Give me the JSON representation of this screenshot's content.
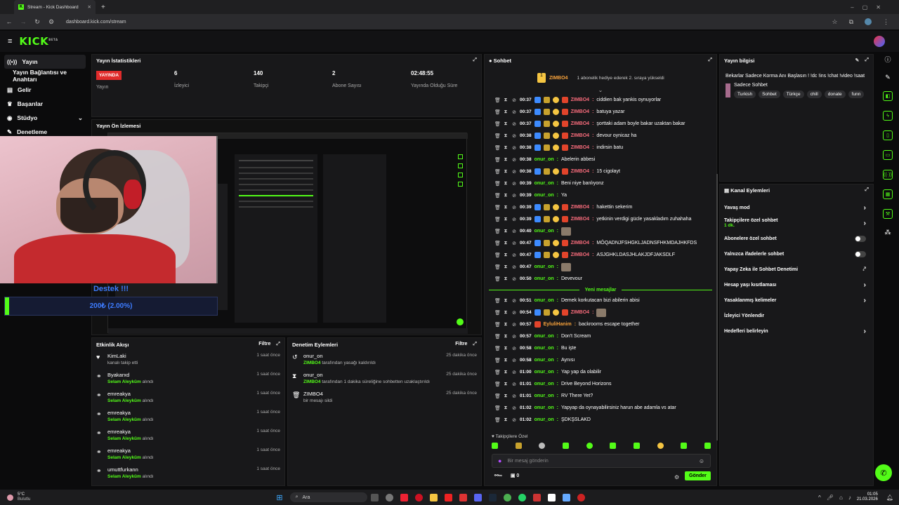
{
  "browser": {
    "tab_title": "Stream - Kick Dashboard",
    "new_tab": "+",
    "url": "dashboard.kick.com/stream"
  },
  "app": {
    "logo": "KICK",
    "logo_sup": "BETA"
  },
  "sidebar": {
    "items": [
      {
        "label": "Yayın",
        "icon": "broadcast-icon"
      },
      {
        "label": "Yayın Bağlantısı ve Anahtarı",
        "icon": ""
      },
      {
        "label": "Gelir",
        "icon": "wallet-icon"
      },
      {
        "label": "Başarılar",
        "icon": "trophy-icon"
      },
      {
        "label": "Stüdyo",
        "icon": "studio-icon"
      },
      {
        "label": "Denetleme",
        "icon": "shield-icon"
      }
    ]
  },
  "stats": {
    "title": "Yayın İstatistikleri",
    "live_badge": "YAYINDA",
    "live_label": "Yayın",
    "viewers": "6",
    "viewers_label": "İzleyici",
    "followers": "140",
    "followers_label": "Takipçi",
    "subs": "2",
    "subs_label": "Abone Sayısı",
    "uptime": "02:48:55",
    "uptime_label": "Yayında Olduğu Süre"
  },
  "preview": {
    "title": "Yayın Ön İzlemesi",
    "overlay_title": "Destek !!!",
    "overlay_amount": "200₺ (2.00%)"
  },
  "activity": {
    "title": "Etkinlik Akışı",
    "filter": "Filtre",
    "items": [
      {
        "user": "KimLaki",
        "pre": "",
        "bold": "",
        "rest": "kanalı takip etti",
        "time": "1 saat önce",
        "icon": "heart-icon"
      },
      {
        "user": "Byakarxd",
        "pre": "",
        "bold": "Selam Aleyküm",
        "rest": " alındı",
        "time": "1 saat önce",
        "icon": "reward-icon"
      },
      {
        "user": "emreakya",
        "pre": "",
        "bold": "Selam Aleyküm",
        "rest": " alındı",
        "time": "1 saat önce",
        "icon": "reward-icon"
      },
      {
        "user": "emreakya",
        "pre": "",
        "bold": "Selam Aleyküm",
        "rest": " alındı",
        "time": "1 saat önce",
        "icon": "reward-icon"
      },
      {
        "user": "emreakya",
        "pre": "",
        "bold": "Selam Aleyküm",
        "rest": " alındı",
        "time": "1 saat önce",
        "icon": "reward-icon"
      },
      {
        "user": "emreakya",
        "pre": "",
        "bold": "Selam Aleyküm",
        "rest": " alındı",
        "time": "1 saat önce",
        "icon": "reward-icon"
      },
      {
        "user": "umuttfurkann",
        "pre": "",
        "bold": "Selam Aleyküm",
        "rest": " alındı",
        "time": "1 saat önce",
        "icon": "reward-icon"
      }
    ]
  },
  "moderation": {
    "title": "Denetim Eylemleri",
    "filter": "Filtre",
    "items": [
      {
        "user": "onur_on",
        "bold": "ZIMBO4",
        "rest": " tarafından yasağı kaldırıldı",
        "time": "25 dakika önce",
        "icon": "undo-icon"
      },
      {
        "user": "onur_on",
        "bold": "ZIMBO4",
        "rest": " tarafından 1 dakika süreliğine sohbetten uzaklaştırıldı",
        "time": "25 dakika önce",
        "icon": "hourglass-icon"
      },
      {
        "user": "ZIMBO4",
        "bold": "",
        "rest": "bir mesajı sildi",
        "time": "25 dakika önce",
        "icon": "trash-icon"
      }
    ]
  },
  "chat": {
    "title": "Sohbet",
    "pinned_user": "ZIMBO4",
    "pinned_text": "1 abonelik hediye ederek 2. sıraya yükseldi",
    "messages": [
      {
        "time": "00:37",
        "user": "ZIMBO4",
        "text": "ciddien bak yankis oynuyorlar",
        "type": "z"
      },
      {
        "time": "00:37",
        "user": "ZIMBO4",
        "text": "batuya yazar",
        "type": "z"
      },
      {
        "time": "00:37",
        "user": "ZIMBO4",
        "text": "şorttaki adam boyle bakar uzaktan bakar",
        "type": "z"
      },
      {
        "time": "00:38",
        "user": "ZIMBO4",
        "text": "devour oynicaz ha",
        "type": "z"
      },
      {
        "time": "00:38",
        "user": "ZIMBO4",
        "text": "indirsin batu",
        "type": "z"
      },
      {
        "time": "00:38",
        "user": "onur_on",
        "text": "Abelerin abbesi",
        "type": "o"
      },
      {
        "time": "00:38",
        "user": "ZIMBO4",
        "text": "15 cigolayt",
        "type": "z"
      },
      {
        "time": "00:39",
        "user": "onur_on",
        "text": "Beni niye banlıyonz",
        "type": "o"
      },
      {
        "time": "00:39",
        "user": "onur_on",
        "text": "Ya",
        "type": "o"
      },
      {
        "time": "00:39",
        "user": "ZIMBO4",
        "text": "hakettin sekerim",
        "type": "z"
      },
      {
        "time": "00:39",
        "user": "ZIMBO4",
        "text": "yetkinin verdigi gücle yasakladım zuhahaha",
        "type": "z"
      },
      {
        "time": "00:40",
        "user": "onur_on",
        "text": "",
        "type": "o",
        "emote": true
      },
      {
        "time": "00:47",
        "user": "ZIMBO4",
        "text": "MÖQADNJFSHGKLJADNSFHKMDAJHKFDS",
        "type": "z"
      },
      {
        "time": "00:47",
        "user": "ZIMBO4",
        "text": "ASJGHKLDASJHLAKJDFJAKSDLF",
        "type": "z"
      },
      {
        "time": "00:47",
        "user": "onur_on",
        "text": "",
        "type": "o",
        "emote": true
      },
      {
        "time": "00:50",
        "user": "onur_on",
        "text": "Devevour",
        "type": "o"
      }
    ],
    "new_messages_label": "Yeni mesajlar",
    "messages2": [
      {
        "time": "00:51",
        "user": "onur_on",
        "text": "Demek korkutacan bizi abilerin abisi",
        "type": "o"
      },
      {
        "time": "00:54",
        "user": "ZIMBO4",
        "text": "",
        "type": "z",
        "emote": true
      },
      {
        "time": "00:57",
        "user": "EyluliHanim",
        "text": "backrooms escape together",
        "type": "e"
      },
      {
        "time": "00:57",
        "user": "onur_on",
        "text": "Don't Scream",
        "type": "o"
      },
      {
        "time": "00:58",
        "user": "onur_on",
        "text": "Bu işte",
        "type": "o"
      },
      {
        "time": "00:58",
        "user": "onur_on",
        "text": "Aynısı",
        "type": "o"
      },
      {
        "time": "01:00",
        "user": "onur_on",
        "text": "Yap yap da olabilir",
        "type": "o"
      },
      {
        "time": "01:01",
        "user": "onur_on",
        "text": "Drive Beyond Horizons",
        "type": "o"
      },
      {
        "time": "01:01",
        "user": "onur_on",
        "text": "RV There Yet?",
        "type": "o"
      },
      {
        "time": "01:02",
        "user": "onur_on",
        "text": "Yapyap da oynayabilirsiniz harun abe adamla vs atar",
        "type": "o"
      },
      {
        "time": "01:02",
        "user": "onur_on",
        "text": "ŞDKŞSLAKD",
        "type": "o"
      }
    ],
    "followers_only": "Takipçilere Özel",
    "input_placeholder": "Bir mesaj gönderin",
    "points": "0",
    "send": "Gönder"
  },
  "stream_info": {
    "title": "Yayın bilgisi",
    "stream_title": "Bekarlar Sadece Korma Anı Başlasın ! !dc !ins !chat !video !saat",
    "category": "Sadece Sohbet",
    "tags": [
      "Turkish",
      "Sohbet",
      "Türkçe",
      "chill",
      "donate",
      "funn"
    ]
  },
  "channel_actions": {
    "title": "Kanal Eylemleri",
    "items": [
      {
        "label": "Yavaş mod",
        "sub": "",
        "control": "chevron"
      },
      {
        "label": "Takipçilere özel sohbet",
        "sub": "1 dk.",
        "control": "chevron"
      },
      {
        "label": "Abonelere özel sohbet",
        "sub": "",
        "control": "toggle"
      },
      {
        "label": "Yalnızca ifadelerle sohbet",
        "sub": "",
        "control": "toggle"
      },
      {
        "label": "Yapay Zeka ile Sohbet Denetimi",
        "sub": "",
        "control": "external"
      },
      {
        "label": "Hesap yaşı kısıtlaması",
        "sub": "",
        "control": "chevron"
      },
      {
        "label": "Yasaklanmış kelimeler",
        "sub": "",
        "control": "chevron"
      },
      {
        "label": "İzleyici Yönlendir",
        "sub": "",
        "control": "none"
      },
      {
        "label": "Hedefleri belirleyin",
        "sub": "",
        "control": "chevron"
      }
    ]
  },
  "taskbar": {
    "weather_temp": "5°C",
    "weather_desc": "Bulutlu",
    "search": "Ara",
    "time": "01:05",
    "date": "21.03.2026"
  },
  "colors": {
    "accent": "#53fc18",
    "live": "#e02b2b",
    "panel": "#18181a"
  }
}
